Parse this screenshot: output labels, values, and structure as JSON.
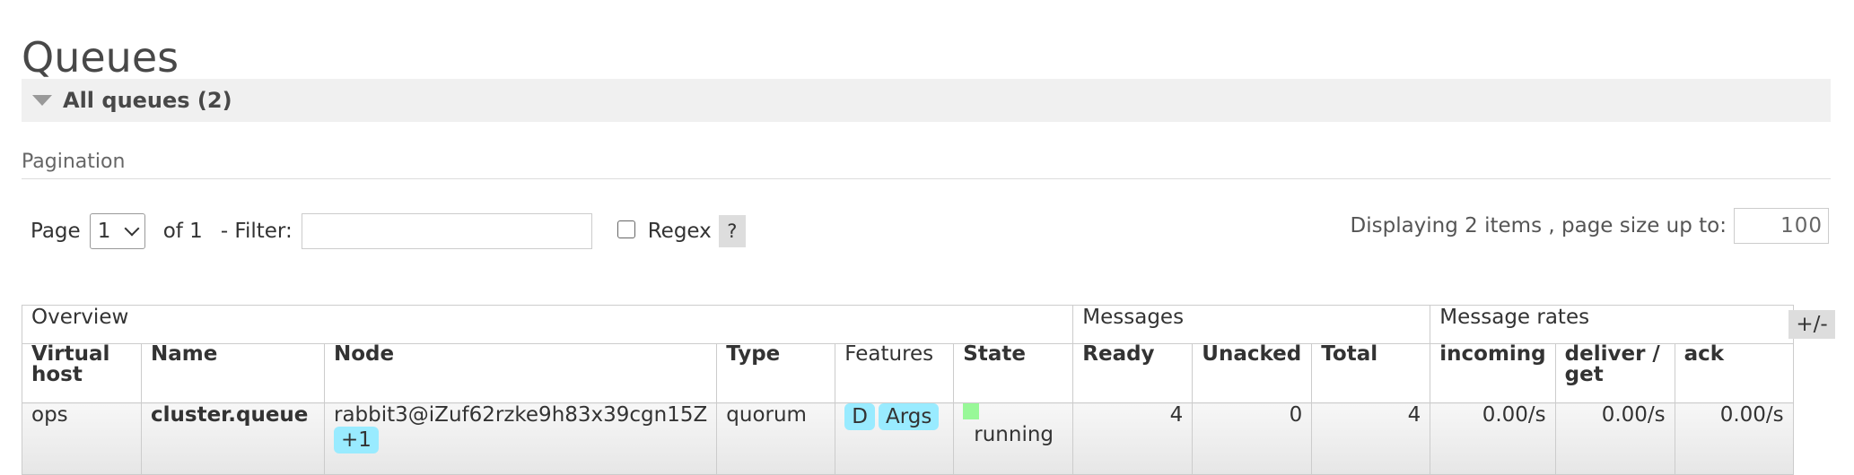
{
  "page": {
    "title": "Queues"
  },
  "section": {
    "label": "All queues (2)"
  },
  "pagination": {
    "heading": "Pagination",
    "page_label": "Page",
    "page_value": "1",
    "of_label": "of 1",
    "filter_label": "- Filter:",
    "filter_value": "",
    "regex_label": "Regex",
    "help_label": "?",
    "display_label": "Displaying 2 items , page size up to:",
    "page_size": "100"
  },
  "table": {
    "groups": [
      "Overview",
      "Messages",
      "Message rates"
    ],
    "toggle_label": "+/-",
    "columns": {
      "vhost_line1": "Virtual",
      "vhost_line2": "host",
      "name": "Name",
      "node": "Node",
      "type": "Type",
      "features": "Features",
      "state": "State",
      "ready": "Ready",
      "unacked": "Unacked",
      "total": "Total",
      "incoming": "incoming",
      "deliver_line1": "deliver /",
      "deliver_line2": "get",
      "ack": "ack"
    },
    "rows": [
      {
        "vhost": "ops",
        "name": "cluster.queue",
        "node": "rabbit3@iZuf62rzke9h83x39cgn15Z",
        "node_extra": "+1",
        "type": "quorum",
        "feature_d": "D",
        "feature_args": "Args",
        "state": "running",
        "ready": "4",
        "unacked": "0",
        "total": "4",
        "incoming": "0.00/s",
        "deliver": "0.00/s",
        "ack": "0.00/s"
      }
    ]
  },
  "colors": {
    "pill": "#99ebff",
    "running": "#98f898",
    "section_bg": "#f0f0f0"
  }
}
